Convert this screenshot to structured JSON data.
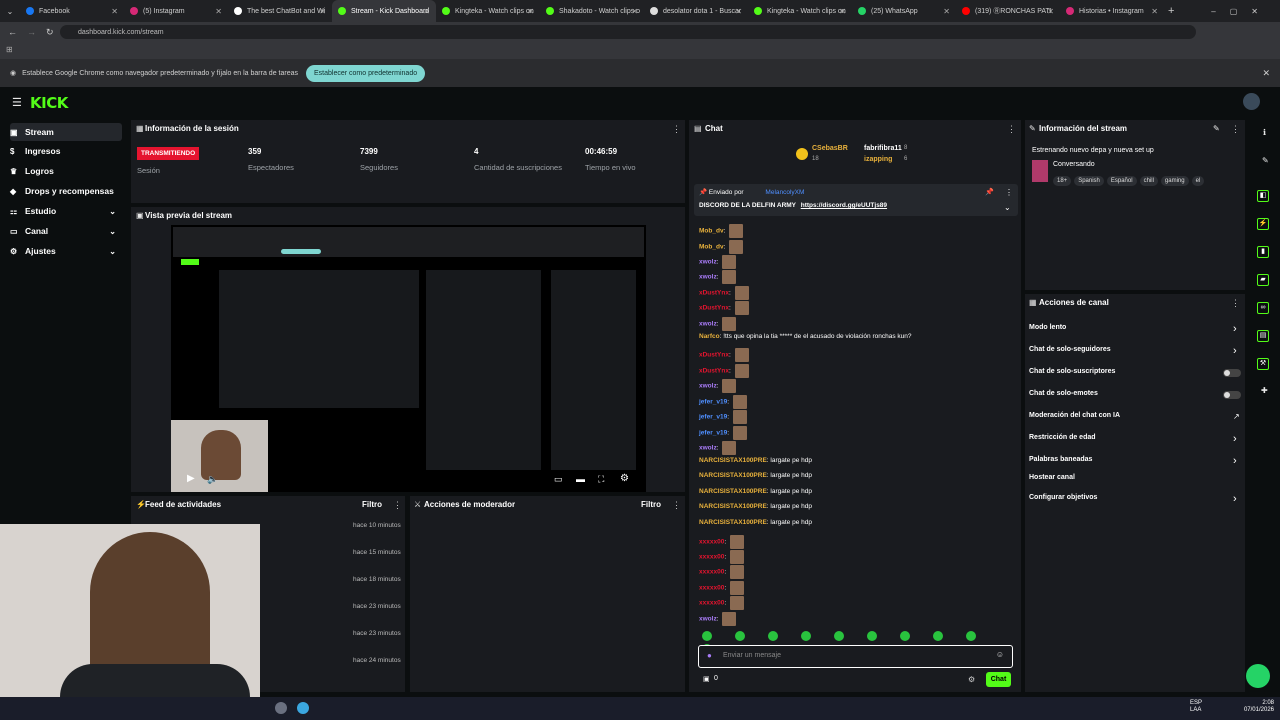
{
  "browser": {
    "tabs": [
      {
        "title": "Facebook",
        "color": "#1877f2"
      },
      {
        "title": "(5) Instagram",
        "color": "#d62976"
      },
      {
        "title": "The best ChatBot and Wi",
        "color": "#ffffff"
      },
      {
        "title": "Stream - Kick Dashboard",
        "color": "#53fc18"
      },
      {
        "title": "Kingteka - Watch clips on",
        "color": "#53fc18"
      },
      {
        "title": "Shakadoto - Watch clips o",
        "color": "#53fc18"
      },
      {
        "title": "desolator dota 1 - Buscar",
        "color": "#dddddd"
      },
      {
        "title": "Kingteka - Watch clips on",
        "color": "#53fc18"
      },
      {
        "title": "(25) WhatsApp",
        "color": "#25d366"
      },
      {
        "title": "(319) ⓇRONCHAS PATI",
        "color": "#ff0000"
      },
      {
        "title": "Historias • Instagram",
        "color": "#d62976"
      }
    ],
    "url": "dashboard.kick.com/stream",
    "infobar_text": "Establece Google Chrome como navegador predeterminado y fíjalo en la barra de tareas",
    "infobar_button": "Establecer como predeterminado"
  },
  "sidebar": {
    "logo": "KICK",
    "items": [
      {
        "label": "Stream",
        "icon": "stream-icon",
        "active": true
      },
      {
        "label": "Ingresos",
        "icon": "money-icon"
      },
      {
        "label": "Logros",
        "icon": "trophy-icon"
      },
      {
        "label": "Drops y recompensas",
        "icon": "gift-icon"
      },
      {
        "label": "Estudio",
        "icon": "studio-icon",
        "chevron": true
      },
      {
        "label": "Canal",
        "icon": "channel-icon",
        "chevron": true
      },
      {
        "label": "Ajustes",
        "icon": "settings-icon",
        "chevron": true
      }
    ]
  },
  "session": {
    "title": "Información de la sesión",
    "status": "TRANSMITIENDO",
    "status_label": "Sesión",
    "viewers": "359",
    "viewers_label": "Espectadores",
    "followers": "7399",
    "followers_label": "Seguidores",
    "subs": "4",
    "subs_label": "Cantidad de suscripciones",
    "time": "00:46:59",
    "time_label": "Tiempo en vivo"
  },
  "preview": {
    "title": "Vista previa del stream"
  },
  "feed": {
    "title": "Feed de actividades",
    "filter": "Filtro",
    "times": [
      "hace 10 minutos",
      "hace 15 minutos",
      "hace 18 minutos",
      "hace 23 minutos",
      "hace 23 minutos",
      "hace 24 minutos"
    ]
  },
  "mod": {
    "title": "Acciones de moderador",
    "filter": "Filtro"
  },
  "chat": {
    "title": "Chat",
    "top_users": [
      {
        "name": "CSebasBR",
        "count": "18"
      },
      {
        "name": "fabrifibra11",
        "count": "8"
      },
      {
        "name": "izapping",
        "count": "6"
      }
    ],
    "pinned_by": "Enviado por",
    "pinned_user": "MelancolyXM",
    "pinned_text": "DISCORD DE LA DELFIN ARMY",
    "pinned_link": "https://discord.gg/eUUTjs89",
    "messages": [
      {
        "user": "Mob_dv",
        "color": "#e8b13c",
        "text": ""
      },
      {
        "user": "Mob_dv",
        "color": "#e8b13c",
        "text": ""
      },
      {
        "user": "xwolz",
        "color": "#a97cf8",
        "text": ""
      },
      {
        "user": "xwolz",
        "color": "#a97cf8",
        "text": ""
      },
      {
        "user": "xDustYnx",
        "color": "#e5142f",
        "text": ""
      },
      {
        "user": "xDustYnx",
        "color": "#e5142f",
        "text": ""
      },
      {
        "user": "xwolz",
        "color": "#a97cf8",
        "text": ""
      },
      {
        "user": "Narfco",
        "color": "#e8b13c",
        "text": "!tts que opina la tia ***** de el acusado de violación ronchas kun?"
      },
      {
        "user": "xDustYnx",
        "color": "#e5142f",
        "text": ""
      },
      {
        "user": "xDustYnx",
        "color": "#e5142f",
        "text": ""
      },
      {
        "user": "xwolz",
        "color": "#a97cf8",
        "text": ""
      },
      {
        "user": "jefer_v19",
        "color": "#4f8fff",
        "text": ""
      },
      {
        "user": "jefer_v19",
        "color": "#4f8fff",
        "text": ""
      },
      {
        "user": "jefer_v19",
        "color": "#4f8fff",
        "text": ""
      },
      {
        "user": "xwolz",
        "color": "#a97cf8",
        "text": ""
      },
      {
        "user": "NARCISISTAX100PRE",
        "color": "#e8b13c",
        "text": "largate pe hdp"
      },
      {
        "user": "NARCISISTAX100PRE",
        "color": "#e8b13c",
        "text": "largate pe hdp"
      },
      {
        "user": "NARCISISTAX100PRE",
        "color": "#e8b13c",
        "text": "largate pe hdp"
      },
      {
        "user": "NARCISISTAX100PRE",
        "color": "#e8b13c",
        "text": "largate pe hdp"
      },
      {
        "user": "NARCISISTAX100PRE",
        "color": "#e8b13c",
        "text": "largate pe hdp"
      },
      {
        "user": "xxxxx00",
        "color": "#e5142f",
        "text": ""
      },
      {
        "user": "xxxxx00",
        "color": "#e5142f",
        "text": ""
      },
      {
        "user": "xxxxx00",
        "color": "#e5142f",
        "text": ""
      },
      {
        "user": "xxxxx00",
        "color": "#e5142f",
        "text": ""
      },
      {
        "user": "xxxxx00",
        "color": "#e5142f",
        "text": ""
      },
      {
        "user": "xwolz",
        "color": "#a97cf8",
        "text": ""
      }
    ],
    "input_placeholder": "Enviar un mensaje",
    "balance": "0",
    "send": "Chat"
  },
  "stream_info": {
    "title": "Información del stream",
    "stream_title": "Estrenando nuevo depa y nueva set up",
    "category": "Conversando",
    "tags": [
      "18+",
      "Spanish",
      "Español",
      "chill",
      "gaming",
      "el"
    ]
  },
  "channel_actions": {
    "title": "Acciones de canal",
    "items": [
      {
        "label": "Modo lento",
        "type": "chevron"
      },
      {
        "label": "Chat de solo-seguidores",
        "type": "chevron"
      },
      {
        "label": "Chat de solo-suscriptores",
        "type": "toggle"
      },
      {
        "label": "Chat de solo-emotes",
        "type": "toggle"
      },
      {
        "label": "Moderación del chat con IA",
        "type": "external"
      },
      {
        "label": "Restricción de edad",
        "type": "chevron"
      },
      {
        "label": "Palabras baneadas",
        "type": "chevron"
      },
      {
        "label": "Hostear canal",
        "type": "none"
      },
      {
        "label": "Configurar objetivos",
        "type": "chevron"
      }
    ]
  },
  "taskbar": {
    "lang": "ESP",
    "region": "LAA",
    "time": "2:08",
    "date": "07/01/2026"
  },
  "colors": {
    "accent": "#53fc18",
    "panel": "#191b1f",
    "bg": "#0b0e0f",
    "live": "#e5142f"
  }
}
